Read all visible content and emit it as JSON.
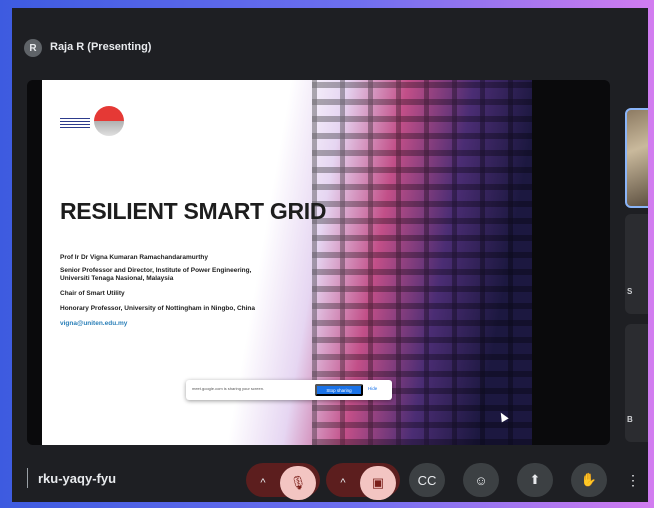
{
  "header": {
    "avatar_initial": "R",
    "presenter_label": "Raja R (Presenting)"
  },
  "slide": {
    "title": "RESILIENT SMART GRID",
    "lines": [
      "Prof Ir Dr Vigna Kumaran Ramachandaramurthy",
      "Senior Professor and Director, Institute of Power Engineering,",
      "Universiti Tenaga Nasional, Malaysia",
      "Chair of Smart Utility",
      "Honorary Professor, University of Nottingham in Ningbo, China",
      "vigna@uniten.edu.my"
    ]
  },
  "share_banner": {
    "message": "meet.google.com is sharing your screen.",
    "stop_label": "Stop sharing",
    "hide_label": "Hide"
  },
  "participants": {
    "tile_2_label": "S",
    "tile_3_label": "B"
  },
  "bottom_bar": {
    "meeting_code": "rku-yaqy-fyu",
    "icons": {
      "mic_options": "^",
      "mic": "🎙",
      "camera_options": "^",
      "camera": "▣",
      "captions": "CC",
      "emoji": "☺",
      "present": "⬆",
      "raise_hand": "✋",
      "more": "⋮"
    }
  }
}
